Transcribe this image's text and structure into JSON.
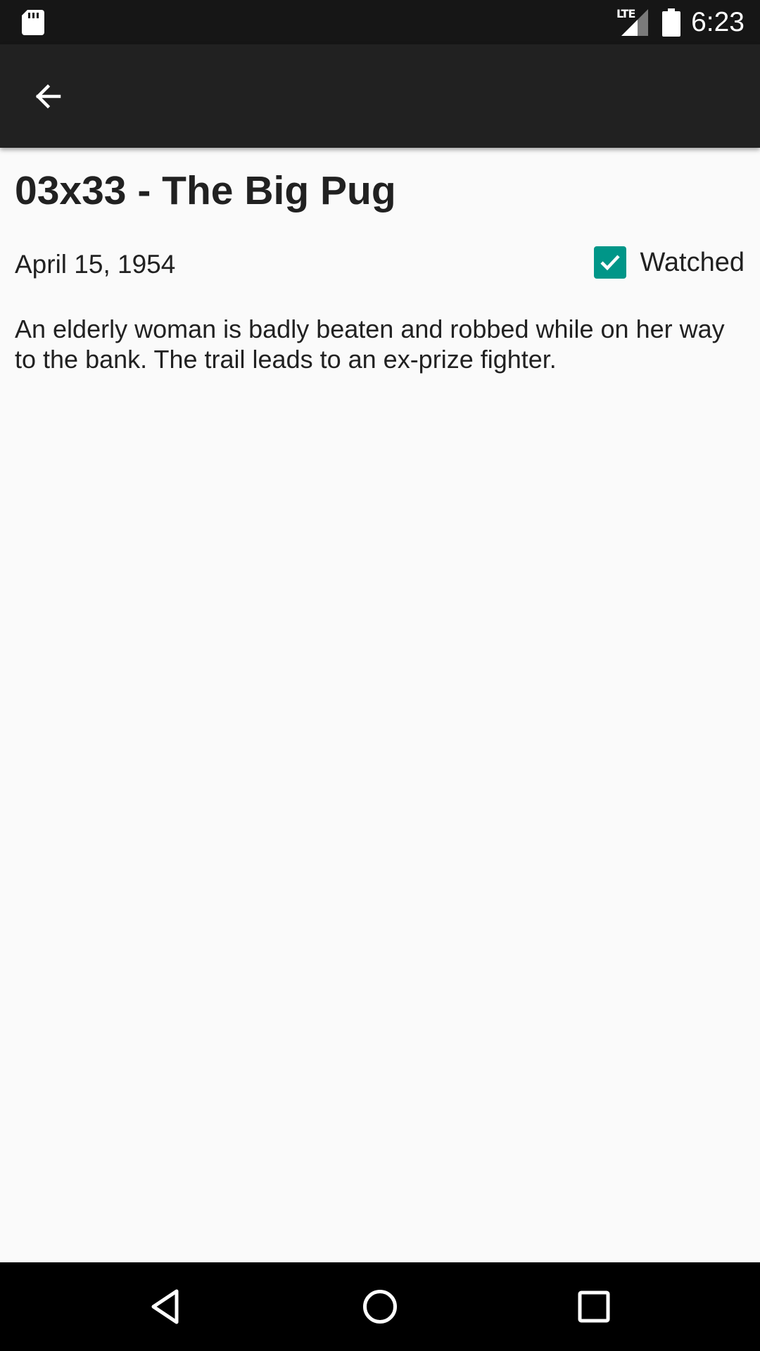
{
  "status_bar": {
    "time": "6:23",
    "network": "LTE",
    "icons": [
      "sd-card-icon",
      "signal-icon",
      "battery-icon"
    ]
  },
  "toolbar": {
    "back_icon": "arrow-back-icon"
  },
  "episode": {
    "title": "03x33 - The Big Pug",
    "air_date": "April 15, 1954",
    "watched_label": "Watched",
    "watched": true,
    "overview": "An elderly woman is badly beaten and robbed while on her way to the bank. The trail leads to an ex-prize fighter."
  },
  "nav_bar": {
    "buttons": [
      "back-triangle-icon",
      "home-circle-icon",
      "recents-square-icon"
    ]
  },
  "colors": {
    "accent": "#009688",
    "toolbar": "#212121",
    "status_bar": "#161616",
    "background": "#fafafa"
  }
}
